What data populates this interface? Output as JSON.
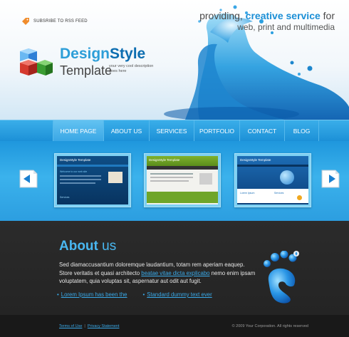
{
  "header": {
    "rss_label": "SUBSRIBE TO RSS FEED",
    "logo": {
      "word1": "Design",
      "word2": "Style",
      "subtitle": "Template",
      "tagline_line1": "your very cool description",
      "tagline_line2": "goes here"
    },
    "tagline": {
      "prefix": "providing, ",
      "highlight": "creative service",
      "suffix": " for",
      "line2": "web, print and multimedia"
    }
  },
  "nav": {
    "items": [
      {
        "label": "HOME PAGE",
        "active": true
      },
      {
        "label": "ABOUT US"
      },
      {
        "label": "SERVICES"
      },
      {
        "label": "PORTFOLIO"
      },
      {
        "label": "CONTACT"
      },
      {
        "label": "BLOG"
      }
    ]
  },
  "showcase": {
    "thumbs": [
      {
        "name": "DesignStyle Template",
        "heading": "Welcome to our web site",
        "foot": "Services"
      },
      {
        "name": "DesignStyle Template"
      },
      {
        "name": "DesignStyle Template",
        "foot_left": "Lorem Ipsum",
        "foot_right": "Services"
      }
    ]
  },
  "about": {
    "title_bold": "About",
    "title_rest": " us",
    "text_before": "Sed diamaccusantium doloremque laudantium, totam rem aperiam eaquep. Store veritatis et quasi architecto ",
    "text_link": "beatae vitae dicta explicabo",
    "text_after": " nemo enim ipsam voluptatem, quia voluptas sit, aspernatur aut odit aut fugit.",
    "bullets": [
      "Lorem Ipsum has been the",
      "Standard dummy text ever"
    ]
  },
  "footer": {
    "terms": "Terms of Use",
    "separator": "|",
    "privacy": "Privacy Statement",
    "copyright": "© 2009 Your Corporation. All rights reserved"
  },
  "colors": {
    "accent": "#2d9ed8",
    "nav": "#2ea3e3",
    "dark": "#2b2b2b"
  }
}
